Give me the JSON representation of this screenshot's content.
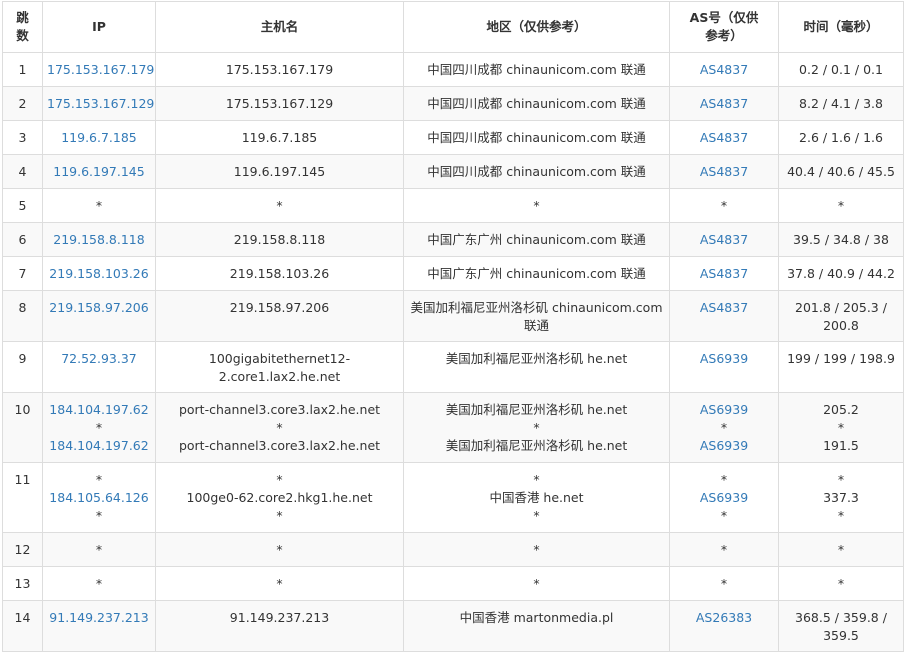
{
  "colors": {
    "link": "#337ab7",
    "text": "#333333",
    "border": "#dddddd",
    "stripe": "#f9f9f9"
  },
  "headers": {
    "hop": "跳数",
    "ip": "IP",
    "host": "主机名",
    "region": "地区（仅供参考）",
    "as": "AS号（仅供参考）",
    "time": "时间（毫秒）"
  },
  "rows": [
    {
      "hop": "1",
      "ip": [
        "175.153.167.179"
      ],
      "host": [
        "175.153.167.179"
      ],
      "region": [
        "中国四川成都 chinaunicom.com 联通"
      ],
      "as": [
        "AS4837"
      ],
      "time": [
        "0.2 / 0.1 / 0.1"
      ]
    },
    {
      "hop": "2",
      "ip": [
        "175.153.167.129"
      ],
      "host": [
        "175.153.167.129"
      ],
      "region": [
        "中国四川成都 chinaunicom.com 联通"
      ],
      "as": [
        "AS4837"
      ],
      "time": [
        "8.2 / 4.1 / 3.8"
      ]
    },
    {
      "hop": "3",
      "ip": [
        "119.6.7.185"
      ],
      "host": [
        "119.6.7.185"
      ],
      "region": [
        "中国四川成都 chinaunicom.com 联通"
      ],
      "as": [
        "AS4837"
      ],
      "time": [
        "2.6 / 1.6 / 1.6"
      ]
    },
    {
      "hop": "4",
      "ip": [
        "119.6.197.145"
      ],
      "host": [
        "119.6.197.145"
      ],
      "region": [
        "中国四川成都 chinaunicom.com 联通"
      ],
      "as": [
        "AS4837"
      ],
      "time": [
        "40.4 / 40.6 / 45.5"
      ]
    },
    {
      "hop": "5",
      "ip": [
        "*"
      ],
      "host": [
        "*"
      ],
      "region": [
        "*"
      ],
      "as": [
        "*"
      ],
      "time": [
        "*"
      ]
    },
    {
      "hop": "6",
      "ip": [
        "219.158.8.118"
      ],
      "host": [
        "219.158.8.118"
      ],
      "region": [
        "中国广东广州 chinaunicom.com 联通"
      ],
      "as": [
        "AS4837"
      ],
      "time": [
        "39.5 / 34.8 / 38"
      ]
    },
    {
      "hop": "7",
      "ip": [
        "219.158.103.26"
      ],
      "host": [
        "219.158.103.26"
      ],
      "region": [
        "中国广东广州 chinaunicom.com 联通"
      ],
      "as": [
        "AS4837"
      ],
      "time": [
        "37.8 / 40.9 / 44.2"
      ]
    },
    {
      "hop": "8",
      "ip": [
        "219.158.97.206"
      ],
      "host": [
        "219.158.97.206"
      ],
      "region": [
        "美国加利福尼亚州洛杉矶 chinaunicom.com 联通"
      ],
      "as": [
        "AS4837"
      ],
      "time": [
        "201.8 / 205.3 / 200.8"
      ]
    },
    {
      "hop": "9",
      "ip": [
        "72.52.93.37"
      ],
      "host": [
        "100gigabitethernet12-2.core1.lax2.he.net"
      ],
      "region": [
        "美国加利福尼亚州洛杉矶 he.net"
      ],
      "as": [
        "AS6939"
      ],
      "time": [
        "199 / 199 / 198.9"
      ]
    },
    {
      "hop": "10",
      "ip": [
        "184.104.197.62",
        "*",
        "184.104.197.62"
      ],
      "host": [
        "port-channel3.core3.lax2.he.net",
        "*",
        "port-channel3.core3.lax2.he.net"
      ],
      "region": [
        "美国加利福尼亚州洛杉矶 he.net",
        "*",
        "美国加利福尼亚州洛杉矶 he.net"
      ],
      "as": [
        "AS6939",
        "*",
        "AS6939"
      ],
      "time": [
        "205.2",
        "*",
        "191.5"
      ]
    },
    {
      "hop": "11",
      "ip": [
        "*",
        "184.105.64.126",
        "*"
      ],
      "host": [
        "*",
        "100ge0-62.core2.hkg1.he.net",
        "*"
      ],
      "region": [
        "*",
        "中国香港 he.net",
        "*"
      ],
      "as": [
        "*",
        "AS6939",
        "*"
      ],
      "time": [
        "*",
        "337.3",
        "*"
      ]
    },
    {
      "hop": "12",
      "ip": [
        "*"
      ],
      "host": [
        "*"
      ],
      "region": [
        "*"
      ],
      "as": [
        "*"
      ],
      "time": [
        "*"
      ]
    },
    {
      "hop": "13",
      "ip": [
        "*"
      ],
      "host": [
        "*"
      ],
      "region": [
        "*"
      ],
      "as": [
        "*"
      ],
      "time": [
        "*"
      ]
    },
    {
      "hop": "14",
      "ip": [
        "91.149.237.213"
      ],
      "host": [
        "91.149.237.213"
      ],
      "region": [
        "中国香港 martonmedia.pl"
      ],
      "as": [
        "AS26383"
      ],
      "time": [
        "368.5 / 359.8 / 359.5"
      ]
    }
  ]
}
